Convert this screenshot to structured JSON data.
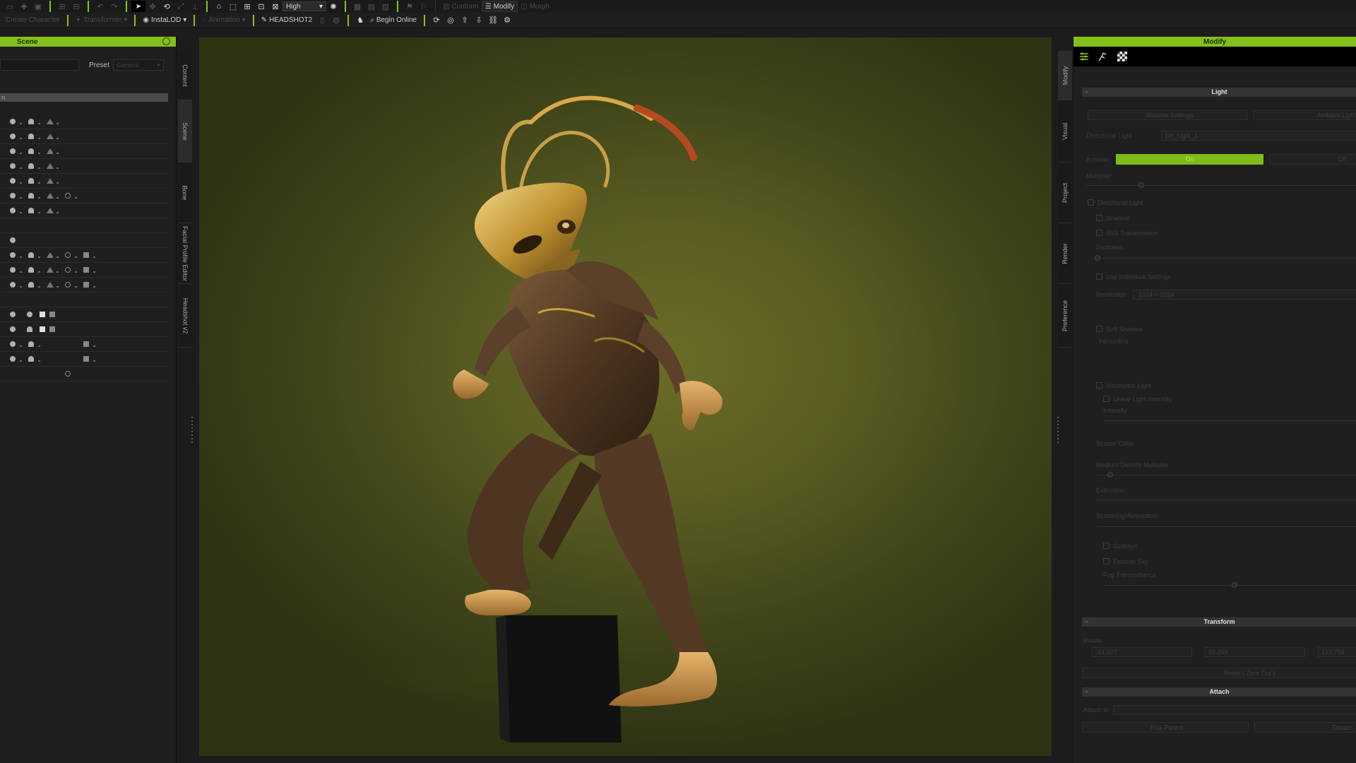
{
  "toolbar": {
    "row1": {
      "quality_select": "High",
      "conform_label": "Conform",
      "modify_label": "Modify",
      "morph_label": "Morph"
    },
    "row2": {
      "create_character_label": "Create Character",
      "transformer_label": "Transformer",
      "instalod_label": "InstaLOD",
      "animation_label": "Animation",
      "headshot2_label": "HEADSHOT2",
      "begin_online_label": "Begin Online"
    }
  },
  "left_panel": {
    "title": "Scene",
    "preset_label": "Preset",
    "preset_value": "General",
    "tree_header": "n",
    "tree_rows": [
      {
        "icons": [
          "dot",
          "bell",
          "tri"
        ]
      },
      {
        "icons": [
          "dot",
          "bell",
          "tri"
        ]
      },
      {
        "icons": [
          "dot",
          "bell",
          "tri"
        ]
      },
      {
        "icons": [
          "dot",
          "bell",
          "tri"
        ]
      },
      {
        "icons": [
          "dot",
          "bell",
          "tri"
        ]
      },
      {
        "icons": [
          "dot",
          "bell",
          "tri",
          "ring"
        ]
      },
      {
        "icons": [
          "dot",
          "bell",
          "tri"
        ]
      },
      {
        "icons": []
      },
      {
        "icons": [
          "dot"
        ]
      },
      {
        "icons": [
          "dot",
          "bell",
          "tri",
          "ring",
          "sq"
        ]
      },
      {
        "icons": [
          "dot",
          "bell",
          "tri",
          "ring",
          "sq"
        ]
      },
      {
        "icons": [
          "dot",
          "bell",
          "tri",
          "ring",
          "sq"
        ]
      },
      {
        "icons": []
      },
      {
        "icons": [
          "dot",
          "dot",
          "sqw",
          "sq"
        ]
      },
      {
        "icons": [
          "dot",
          "bell",
          "sqw",
          "sq"
        ]
      },
      {
        "icons": [
          "dot",
          "bell",
          "sq",
          "sq"
        ]
      },
      {
        "icons": [
          "dot",
          "bell",
          "sq",
          "sq"
        ]
      },
      {
        "icons": [
          "ring"
        ]
      }
    ]
  },
  "left_tabs": [
    "Content",
    "Scene",
    "Bone",
    "Facial Profile Editor",
    "Headshot v2"
  ],
  "right_tabs": [
    "Modify",
    "Visual",
    "Project",
    "Render",
    "Preference"
  ],
  "right_panel": {
    "title": "Modify",
    "light_section": {
      "title": "Light",
      "shadow_settings_label": "Shadow Settings",
      "ambient_light_label": "Ambient Light",
      "directional_light_label": "Directional Light",
      "directional_light_value": "Dir_Light_1",
      "activate_label": "Activate",
      "activate_on": "On",
      "activate_off": "Off",
      "multiplier_label": "Multiplier",
      "directional_light_check": "Directional Light",
      "shadow_check": "Shadow",
      "sss_check": "SSS Transmission",
      "darkness_label": "Darkness",
      "individual_settings_check": "Use Individual Settings",
      "resolution_label": "Resolution",
      "resolution_value": "1024 × 1024",
      "soft_shadow_check": "Soft Shadow",
      "penumbra_label": "Penumbra",
      "volumetric_light_check": "Volumetric Light",
      "linear_light_check": "Linear Light Intensity",
      "intensity_label": "Intensity",
      "scatter_color_label": "Scatter Color",
      "medium_density_label": "Medium Density Multiplier",
      "extinction_label": "Extinction",
      "scattering_label": "Scattering/Absorption",
      "godrays_check": "Godrays",
      "exclude_sky_check": "Exclude Sky",
      "fog_transmittance_label": "Fog Transmittance"
    },
    "transform_section": {
      "title": "Transform",
      "rotate_label": "Rotate",
      "x_value": "-14.027",
      "y_value": "33.259",
      "z_value": "123.734",
      "reset_label": "Reset ( Zero Out )"
    },
    "attach_section": {
      "title": "Attach",
      "attach_to_label": "Attach to",
      "pick_parent_label": "Pick Parent",
      "detach_label": "Detach"
    }
  },
  "colors": {
    "accent": "#84c01a",
    "panel_bg": "#1f1f1f",
    "viewport_bg": "#5a5d22"
  }
}
